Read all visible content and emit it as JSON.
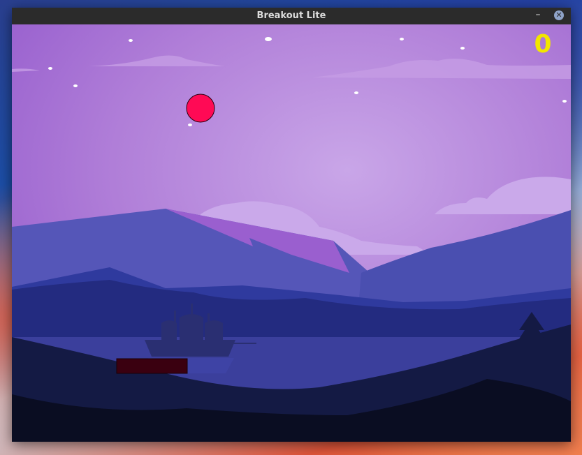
{
  "window": {
    "title": "Breakout Lite",
    "minimize_label": "–",
    "close_label": "✕"
  },
  "game": {
    "score": "0"
  },
  "colors": {
    "ball": "#ff0a55",
    "paddle": "#3a0010",
    "score": "#f2e600",
    "sky_top": "#a36cd6",
    "sky_center": "#c6a0e6"
  }
}
